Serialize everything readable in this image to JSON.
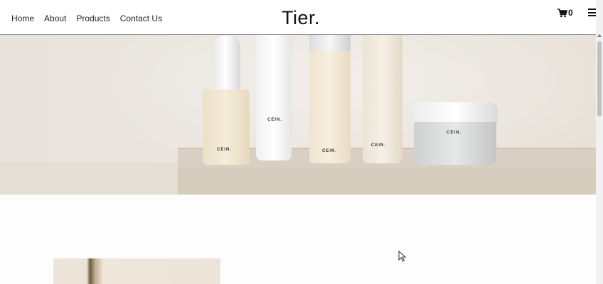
{
  "header": {
    "nav": [
      {
        "label": "Home"
      },
      {
        "label": "About"
      },
      {
        "label": "Products"
      },
      {
        "label": "Contact Us"
      }
    ],
    "brand": "Tier.",
    "cart_count": "0",
    "cart_icon": "cart-icon",
    "menu_icon": "hamburger-menu-icon"
  },
  "hero": {
    "product_labels": [
      "CEIN.",
      "CEIN.",
      "CEIN.",
      "CEIN.",
      "CEIN."
    ]
  },
  "colors": {
    "background": "#ffffff",
    "hero_wall": "#ebe6df",
    "text": "#111111"
  }
}
